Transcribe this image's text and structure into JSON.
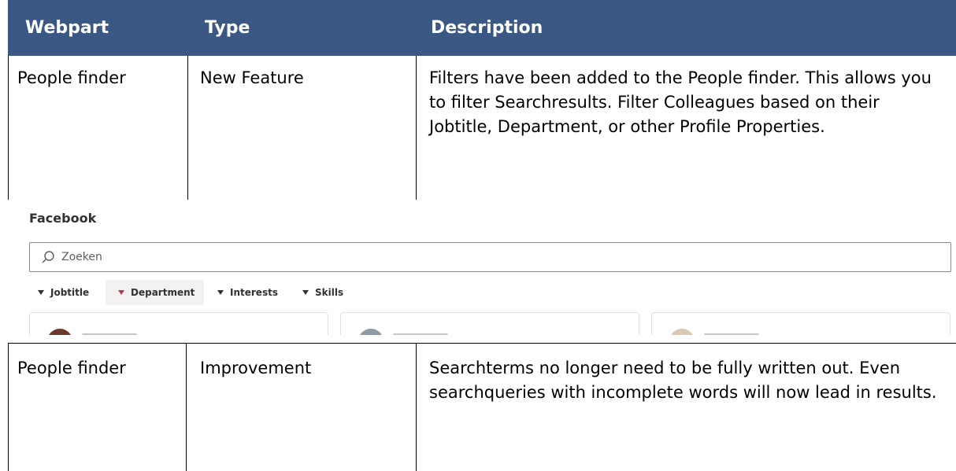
{
  "table": {
    "headers": {
      "webpart": "Webpart",
      "type": "Type",
      "description": "Description"
    },
    "rows": [
      {
        "webpart": "People finder",
        "type": "New Feature",
        "description": "Filters have been added to the People finder. This allows you to filter Searchresults. Filter Colleagues based on their Jobtitle, Department, or other Profile Properties."
      },
      {
        "webpart": "People finder",
        "type": "Improvement",
        "description": "Searchterms no longer need to be fully written out. Even searchqueries with incomplete words will now lead in results."
      }
    ]
  },
  "screenshot": {
    "title": "Facebook",
    "search": {
      "placeholder": "Zoeken",
      "icon": "search-icon"
    },
    "filters": [
      "Jobtitle",
      "Department",
      "Interests",
      "Skills"
    ],
    "active_filter": "Department",
    "colors": {
      "header": "#3b5783",
      "active_filter_arrow": "#c4314b"
    }
  }
}
